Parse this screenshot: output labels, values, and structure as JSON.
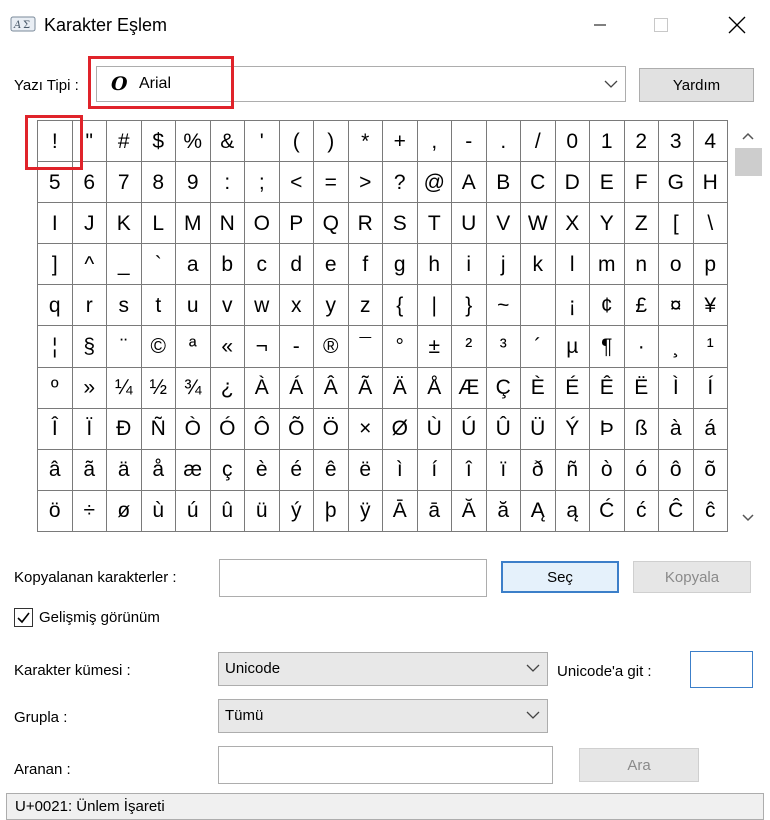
{
  "window": {
    "title": "Karakter Eşlem",
    "icon": "character-map-app-icon"
  },
  "font": {
    "label": "Yazı Tipi :",
    "selected": "Arial",
    "icon_glyph": "O",
    "help_button": "Yardım"
  },
  "highlight_color": "#e0232a",
  "characters": [
    "!",
    "\"",
    "#",
    "$",
    "%",
    "&",
    "'",
    "(",
    ")",
    "*",
    "+",
    ",",
    "-",
    ".",
    "/",
    "0",
    "1",
    "2",
    "3",
    "4",
    "5",
    "6",
    "7",
    "8",
    "9",
    ":",
    ";",
    "<",
    "=",
    ">",
    "?",
    "@",
    "A",
    "B",
    "C",
    "D",
    "E",
    "F",
    "G",
    "H",
    "I",
    "J",
    "K",
    "L",
    "M",
    "N",
    "O",
    "P",
    "Q",
    "R",
    "S",
    "T",
    "U",
    "V",
    "W",
    "X",
    "Y",
    "Z",
    "[",
    "\\",
    "]",
    "^",
    "_",
    "`",
    "a",
    "b",
    "c",
    "d",
    "e",
    "f",
    "g",
    "h",
    "i",
    "j",
    "k",
    "l",
    "m",
    "n",
    "o",
    "p",
    "q",
    "r",
    "s",
    "t",
    "u",
    "v",
    "w",
    "x",
    "y",
    "z",
    "{",
    "|",
    "}",
    "~",
    " ",
    "¡",
    "¢",
    "£",
    "¤",
    "¥",
    "¦",
    "§",
    "¨",
    "©",
    "ª",
    "«",
    "¬",
    "-",
    "®",
    "¯",
    "°",
    "±",
    "²",
    "³",
    "´",
    "µ",
    "¶",
    "·",
    "¸",
    "¹",
    "º",
    "»",
    "¼",
    "½",
    "¾",
    "¿",
    "À",
    "Á",
    "Â",
    "Ã",
    "Ä",
    "Å",
    "Æ",
    "Ç",
    "È",
    "É",
    "Ê",
    "Ë",
    "Ì",
    "Í",
    "Î",
    "Ï",
    "Ð",
    "Ñ",
    "Ò",
    "Ó",
    "Ô",
    "Õ",
    "Ö",
    "×",
    "Ø",
    "Ù",
    "Ú",
    "Û",
    "Ü",
    "Ý",
    "Þ",
    "ß",
    "à",
    "á",
    "â",
    "ã",
    "ä",
    "å",
    "æ",
    "ç",
    "è",
    "é",
    "ê",
    "ë",
    "ì",
    "í",
    "î",
    "ï",
    "ð",
    "ñ",
    "ò",
    "ó",
    "ô",
    "õ",
    "ö",
    "÷",
    "ø",
    "ù",
    "ú",
    "û",
    "ü",
    "ý",
    "þ",
    "ÿ",
    "Ā",
    "ā",
    "Ă",
    "ă",
    "Ą",
    "ą",
    "Ć",
    "ć",
    "Ĉ",
    "ĉ"
  ],
  "copy": {
    "label": "Kopyalanan karakterler :",
    "value": "",
    "select_button": "Seç",
    "copy_button": "Kopyala"
  },
  "advanced": {
    "label": "Gelişmiş görünüm",
    "checked": true
  },
  "charset": {
    "label": "Karakter kümesi :",
    "value": "Unicode",
    "goto_label": "Unicode'a git :",
    "goto_value": ""
  },
  "group": {
    "label": "Grupla :",
    "value": "Tümü"
  },
  "search": {
    "label": "Aranan :",
    "value": "",
    "button": "Ara"
  },
  "status": {
    "text": "U+0021: Ünlem İşareti"
  }
}
